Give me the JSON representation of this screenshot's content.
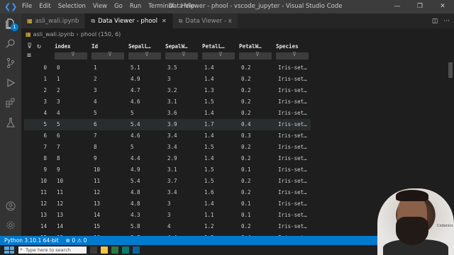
{
  "titlebar": {
    "menu": [
      "File",
      "Edit",
      "Selection",
      "View",
      "Go",
      "Run",
      "Terminal",
      "Help"
    ],
    "title": "Data Viewer - phool - vscode_jupyter - Visual Studio Code"
  },
  "tabs": [
    {
      "label": "asli_wali.ipynb",
      "active": false
    },
    {
      "label": "Data Viewer - phool",
      "active": true
    },
    {
      "label": "Data Viewer - x",
      "active": false
    }
  ],
  "breadcrumb": {
    "file": "asli_wali.ipynb",
    "item": "phool (150, 6)"
  },
  "grid": {
    "columns": [
      "index",
      "Id",
      "SepalL…",
      "SepalW…",
      "PetalL…",
      "PetalW…",
      "Species"
    ],
    "rows": [
      [
        "0",
        "0",
        "1",
        "5.1",
        "3.5",
        "1.4",
        "0.2",
        "Iris-set…"
      ],
      [
        "1",
        "1",
        "2",
        "4.9",
        "3",
        "1.4",
        "0.2",
        "Iris-set…"
      ],
      [
        "2",
        "2",
        "3",
        "4.7",
        "3.2",
        "1.3",
        "0.2",
        "Iris-set…"
      ],
      [
        "3",
        "3",
        "4",
        "4.6",
        "3.1",
        "1.5",
        "0.2",
        "Iris-set…"
      ],
      [
        "4",
        "4",
        "5",
        "5",
        "3.6",
        "1.4",
        "0.2",
        "Iris-set…"
      ],
      [
        "5",
        "5",
        "6",
        "5.4",
        "3.9",
        "1.7",
        "0.4",
        "Iris-set…"
      ],
      [
        "6",
        "6",
        "7",
        "4.6",
        "3.4",
        "1.4",
        "0.3",
        "Iris-set…"
      ],
      [
        "7",
        "7",
        "8",
        "5",
        "3.4",
        "1.5",
        "0.2",
        "Iris-set…"
      ],
      [
        "8",
        "8",
        "9",
        "4.4",
        "2.9",
        "1.4",
        "0.2",
        "Iris-set…"
      ],
      [
        "9",
        "9",
        "10",
        "4.9",
        "3.1",
        "1.5",
        "0.1",
        "Iris-set…"
      ],
      [
        "10",
        "10",
        "11",
        "5.4",
        "3.7",
        "1.5",
        "0.2",
        "Iris-set…"
      ],
      [
        "11",
        "11",
        "12",
        "4.8",
        "3.4",
        "1.6",
        "0.2",
        "Iris-set…"
      ],
      [
        "12",
        "12",
        "13",
        "4.8",
        "3",
        "1.4",
        "0.1",
        "Iris-set…"
      ],
      [
        "13",
        "13",
        "14",
        "4.3",
        "3",
        "1.1",
        "0.1",
        "Iris-set…"
      ],
      [
        "14",
        "14",
        "15",
        "5.8",
        "4",
        "1.2",
        "0.2",
        "Iris-set…"
      ],
      [
        "15",
        "15",
        "16",
        "5.7",
        "4.4",
        "1.5",
        "0.4",
        "Iris-set…"
      ]
    ]
  },
  "statusbar": {
    "python": "Python 3.10.1 64-bit",
    "problems": "⊗ 0 ⚠ 0"
  },
  "taskbar": {
    "search_placeholder": "Type here to search"
  },
  "webcam": {
    "watermark": "Codanics"
  }
}
